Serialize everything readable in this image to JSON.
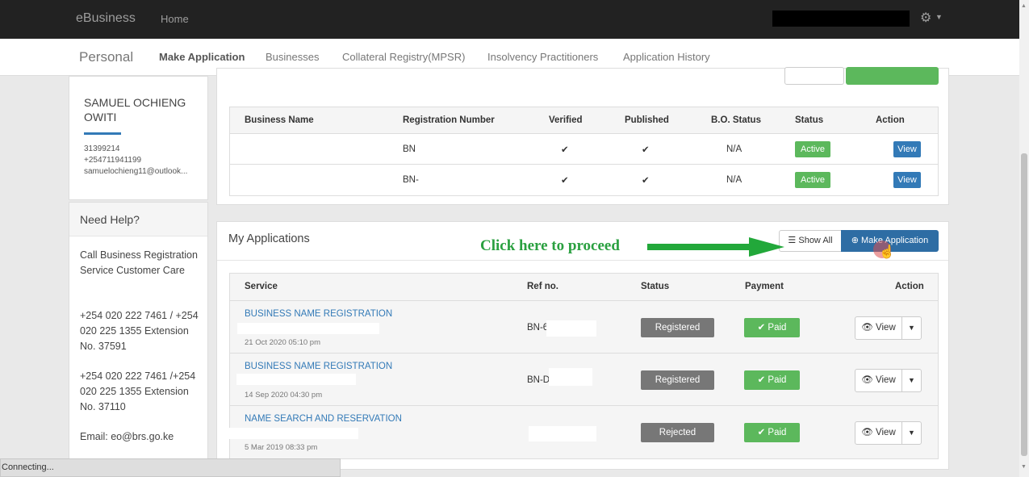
{
  "navbar": {
    "brand": "eBusiness",
    "home": "Home"
  },
  "subnav": {
    "section": "Personal",
    "links": [
      "Make Application",
      "Businesses",
      "Collateral Registry(MPSR)",
      "Insolvency Practitioners",
      "Application History"
    ]
  },
  "profile": {
    "name": "SAMUEL OCHIENG OWITI",
    "id": "31399214",
    "phone": "+254711941199",
    "email": "samuelochieng11@outlook..."
  },
  "help": {
    "title": "Need Help?",
    "call": "Call Business Registration Service Customer Care",
    "phones1": "+254 020 222 7461 / +254 020 225 1355 Extension No. 37591",
    "phones2": "+254 020 222 7461 /+254 020 225 1355 Extension No. 37110",
    "email": "Email: eo@brs.go.ke"
  },
  "businesses": {
    "columns": [
      "Business Name",
      "Registration Number",
      "Verified",
      "Published",
      "B.O. Status",
      "Status",
      "Action"
    ],
    "rows": [
      {
        "reg": "BN",
        "verified": "✔",
        "published": "✔",
        "bo": "N/A",
        "status": "Active",
        "action": "View"
      },
      {
        "reg": "BN-",
        "verified": "✔",
        "published": "✔",
        "bo": "N/A",
        "status": "Active",
        "action": "View"
      }
    ]
  },
  "applications": {
    "title": "My Applications",
    "show_all": "Show All",
    "make_application": "Make Application",
    "columns": [
      "Service",
      "Ref no.",
      "Status",
      "Payment",
      "Action"
    ],
    "rows": [
      {
        "service": "BUSINESS NAME REGISTRATION",
        "date": "21 Oct 2020 05:10 pm",
        "ref": "BN-6",
        "status": "Registered",
        "payment": "Paid",
        "action": "View"
      },
      {
        "service": "BUSINESS NAME REGISTRATION",
        "date": "14 Sep 2020 04:30 pm",
        "ref": "BN-D",
        "status": "Registered",
        "payment": "Paid",
        "action": "View"
      },
      {
        "service": "NAME SEARCH AND RESERVATION",
        "date": "5 Mar 2019 08:33 pm",
        "ref": "",
        "status": "Rejected",
        "payment": "Paid",
        "action": "View"
      }
    ]
  },
  "annotation": "Click here to proceed",
  "browser_status": "Connecting...",
  "colors": {
    "accent": "#337ab7",
    "success": "#5cb85c",
    "annotation": "#2aa040"
  }
}
